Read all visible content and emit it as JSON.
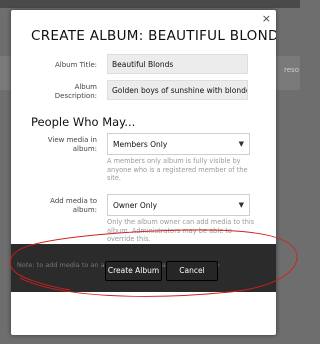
{
  "background": {
    "right_text": "reso"
  },
  "dialog": {
    "close_glyph": "×",
    "title": "CREATE ALBUM: BEAUTIFUL BLONDS",
    "album_title_label": "Album Title:",
    "album_title_value": "Beautiful Blonds",
    "album_desc_label_1": "Album",
    "album_desc_label_2": "Description:",
    "album_desc_value": "Golden boys of sunshine with blonde ha",
    "section_title": "People Who May...",
    "view_label_1": "View media in",
    "view_label_2": "album:",
    "view_value": "Members Only",
    "view_help": "A members only album is fully visible by anyone who is a registered member of the site.",
    "add_label_1": "Add media to",
    "add_label_2": "album:",
    "add_value": "Owner Only",
    "add_help": "Only the album owner can add media to this album. Administrators may be able to override this.",
    "warning_text": "Note: to add media to an album, you must have permission to",
    "create_label": "Create Album",
    "cancel_label": "Cancel"
  },
  "colors": {
    "annotation": "#d21f1f",
    "button": "#262626",
    "warning_bg": "#2b2b2b"
  }
}
